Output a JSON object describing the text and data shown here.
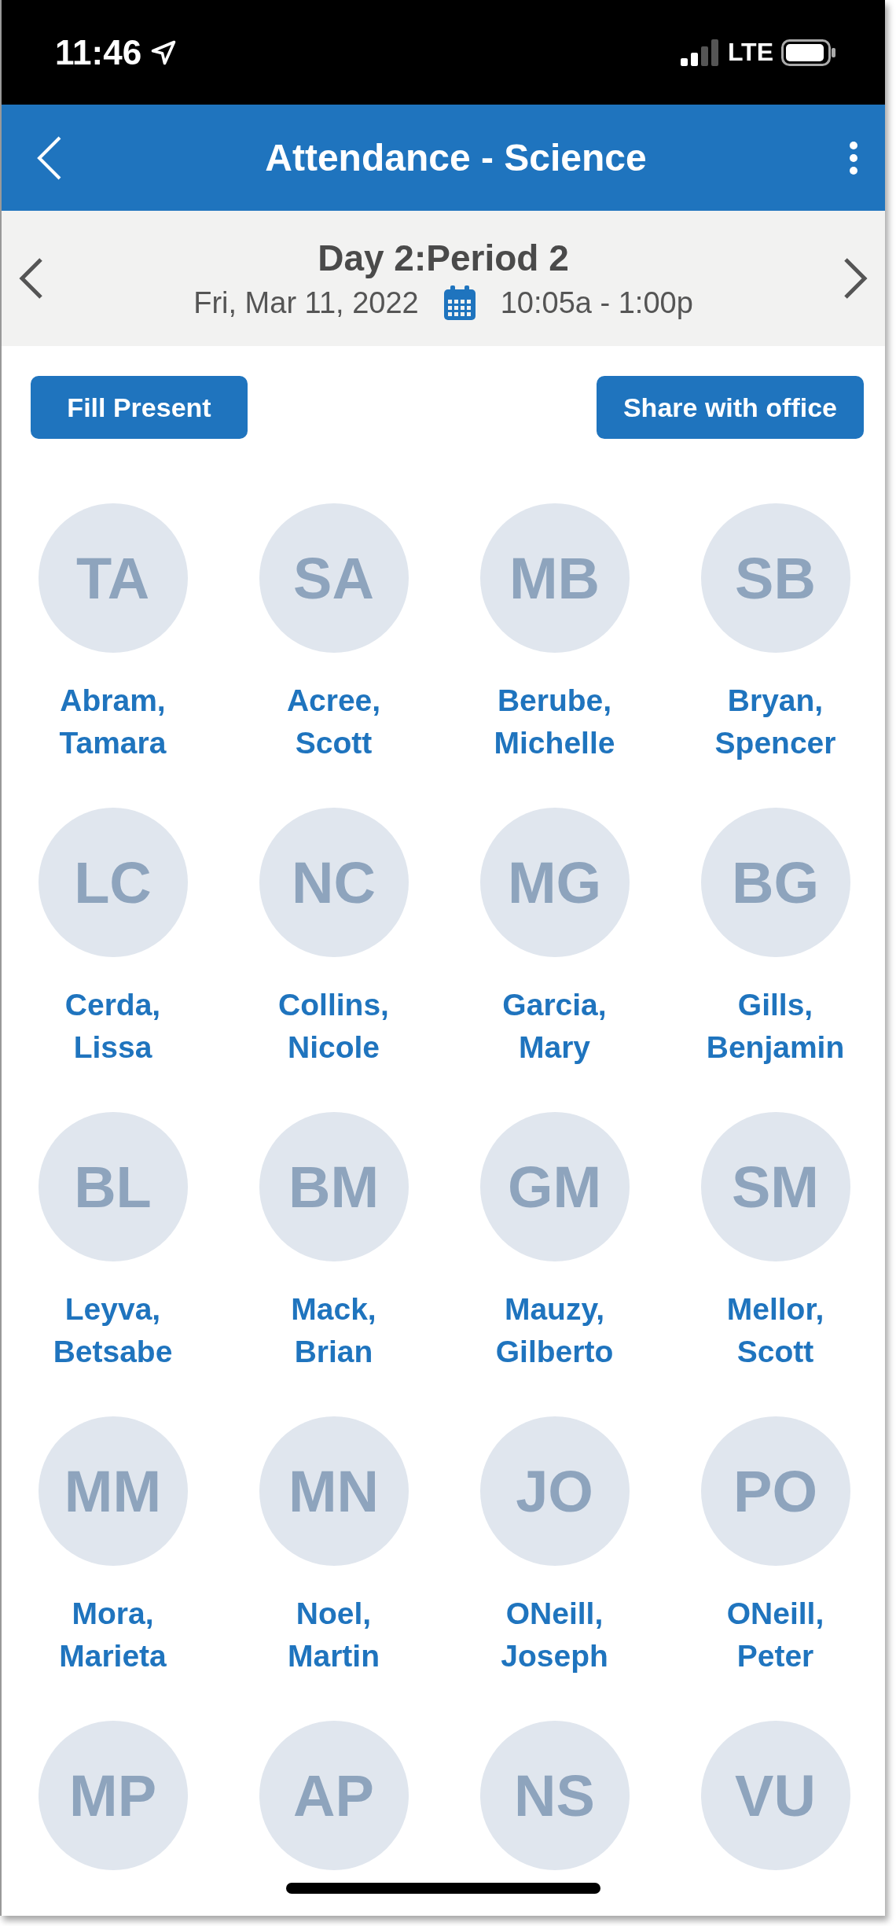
{
  "status_bar": {
    "time": "11:46",
    "network": "LTE"
  },
  "header": {
    "title": "Attendance - Science"
  },
  "period": {
    "title": "Day 2:Period 2",
    "date": "Fri, Mar 11, 2022",
    "time": "10:05a - 1:00p"
  },
  "actions": [
    {
      "label": "Fill Present"
    },
    {
      "label": "Share with office"
    }
  ],
  "students": [
    {
      "initials": "TA",
      "name": "Abram, Tamara"
    },
    {
      "initials": "SA",
      "name": "Acree, Scott"
    },
    {
      "initials": "MB",
      "name": "Berube, Michelle"
    },
    {
      "initials": "SB",
      "name": "Bryan, Spencer"
    },
    {
      "initials": "LC",
      "name": "Cerda, Lissa"
    },
    {
      "initials": "NC",
      "name": "Collins, Nicole"
    },
    {
      "initials": "MG",
      "name": "Garcia, Mary"
    },
    {
      "initials": "BG",
      "name": "Gills, Benjamin"
    },
    {
      "initials": "BL",
      "name": "Leyva, Betsabe"
    },
    {
      "initials": "BM",
      "name": "Mack, Brian"
    },
    {
      "initials": "GM",
      "name": "Mauzy, Gilberto"
    },
    {
      "initials": "SM",
      "name": "Mellor, Scott"
    },
    {
      "initials": "MM",
      "name": "Mora, Marieta"
    },
    {
      "initials": "MN",
      "name": "Noel, Martin"
    },
    {
      "initials": "JO",
      "name": "ONeill, Joseph"
    },
    {
      "initials": "PO",
      "name": "ONeill, Peter"
    },
    {
      "initials": "MP"
    },
    {
      "initials": "AP"
    },
    {
      "initials": "NS"
    },
    {
      "initials": "VU"
    }
  ]
}
